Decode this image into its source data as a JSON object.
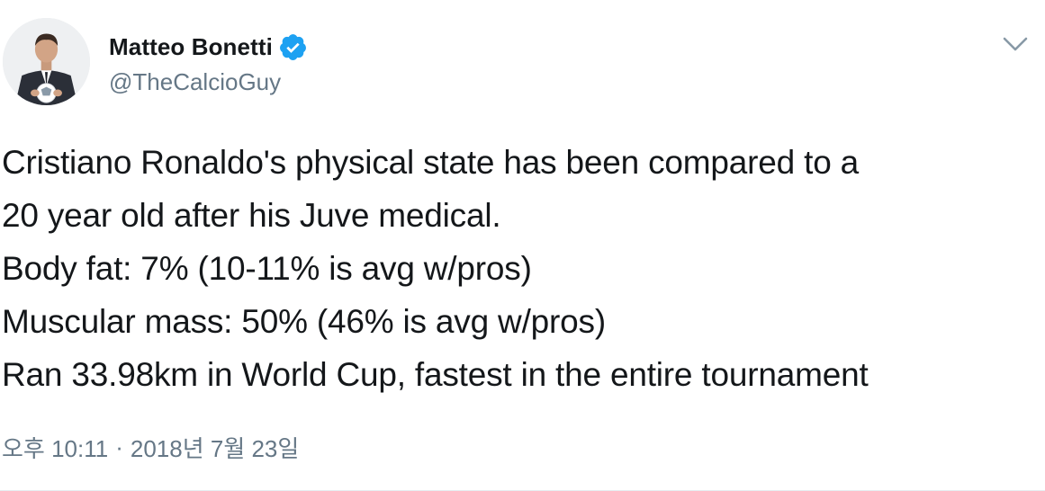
{
  "user": {
    "display_name": "Matteo Bonetti",
    "handle": "@TheCalcioGuy",
    "verified_icon": "verified-badge-icon"
  },
  "tweet": {
    "lines": [
      "Cristiano Ronaldo's physical state has been compared to a",
      "20 year old after his Juve medical.",
      "Body fat: 7% (10-11% is avg w/pros)",
      "Muscular mass: 50% (46% is avg w/pros)",
      "Ran 33.98km in World Cup, fastest in the entire tournament"
    ]
  },
  "meta": {
    "time": "오후 10:11",
    "separator": "·",
    "date": "2018년 7월 23일"
  },
  "colors": {
    "text": "#14171a",
    "secondary": "#657786",
    "verified": "#1da1f2"
  },
  "icons": {
    "menu": "chevron-down-icon",
    "avatar": "avatar"
  }
}
